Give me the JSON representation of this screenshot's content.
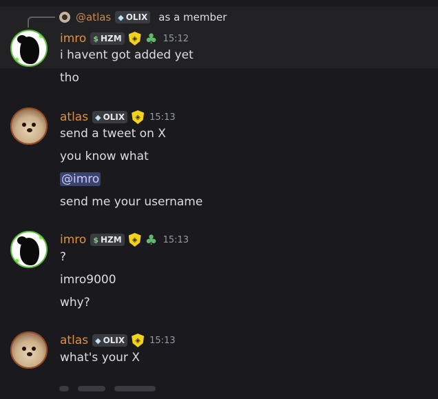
{
  "reply": {
    "username": "@atlas",
    "tag": "OLIX",
    "text": "as a member"
  },
  "messages": [
    {
      "username": "imro",
      "tag": "HZM",
      "tag_icon": "money-icon",
      "badges": [
        "shield-badge-icon",
        "clover-badge-icon"
      ],
      "time": "15:12",
      "lines": [
        "i havent got added yet",
        "tho"
      ]
    },
    {
      "username": "atlas",
      "tag": "OLIX",
      "tag_icon": "diamond-icon",
      "badges": [
        "shield-badge-icon"
      ],
      "time": "15:13",
      "lines": [
        "send a tweet on X",
        "you know what",
        "@imro",
        "send me your username"
      ]
    },
    {
      "username": "imro",
      "tag": "HZM",
      "tag_icon": "money-icon",
      "badges": [
        "shield-badge-icon",
        "clover-badge-icon"
      ],
      "time": "15:13",
      "lines": [
        "?",
        "imro9000",
        "why?"
      ]
    },
    {
      "username": "atlas",
      "tag": "OLIX",
      "tag_icon": "diamond-icon",
      "badges": [
        "shield-badge-icon"
      ],
      "time": "15:13",
      "lines": [
        "what's your X"
      ]
    }
  ],
  "colors": {
    "background": "#1a1a1e",
    "highlight": "#222225",
    "username": "#e0913d",
    "mention_bg": "#3c4270",
    "mention_fg": "#c9cdfb"
  }
}
